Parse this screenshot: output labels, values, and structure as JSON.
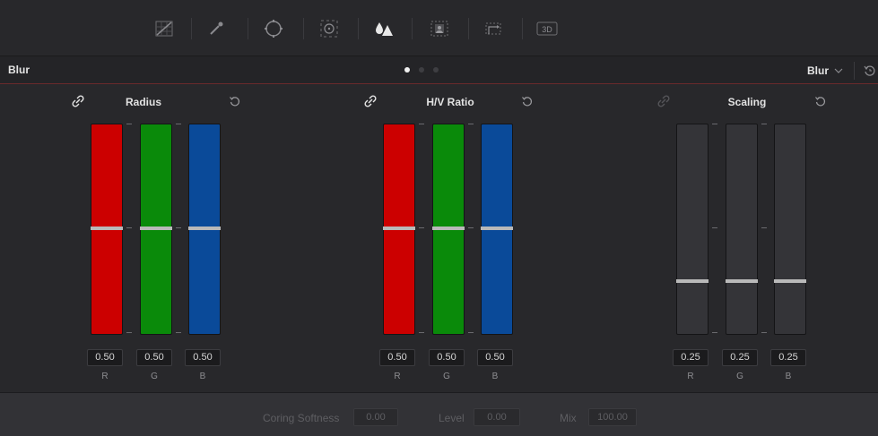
{
  "toolbar": {
    "tools": [
      {
        "id": "curves",
        "icon": "curves-grid-icon"
      },
      {
        "id": "qualifier",
        "icon": "eyedropper-icon"
      },
      {
        "id": "window",
        "icon": "power-window-icon"
      },
      {
        "id": "tracker",
        "icon": "tracker-target-icon"
      },
      {
        "id": "blur",
        "icon": "blur-drops-icon",
        "active": true
      },
      {
        "id": "key",
        "icon": "key-icon"
      },
      {
        "id": "sizing",
        "icon": "sizing-icon"
      },
      {
        "id": "3d",
        "icon": "3d-icon",
        "text": "3D"
      }
    ]
  },
  "header": {
    "title": "Blur",
    "mode_value": "Blur",
    "page_dots": 3,
    "active_dot": 0
  },
  "groups": [
    {
      "label": "Radius",
      "linked": true,
      "channels": [
        {
          "name": "R",
          "value": "0.50",
          "level": 0.5,
          "color": "#cc0000"
        },
        {
          "name": "G",
          "value": "0.50",
          "level": 0.5,
          "color": "#0a8a0a"
        },
        {
          "name": "B",
          "value": "0.50",
          "level": 0.5,
          "color": "#0a4a99"
        }
      ]
    },
    {
      "label": "H/V Ratio",
      "linked": true,
      "channels": [
        {
          "name": "R",
          "value": "0.50",
          "level": 0.5,
          "color": "#cc0000"
        },
        {
          "name": "G",
          "value": "0.50",
          "level": 0.5,
          "color": "#0a8a0a"
        },
        {
          "name": "B",
          "value": "0.50",
          "level": 0.5,
          "color": "#0a4a99"
        }
      ]
    },
    {
      "label": "Scaling",
      "linked": false,
      "channels": [
        {
          "name": "R",
          "value": "0.25",
          "level": 0.25,
          "color": "#343438"
        },
        {
          "name": "G",
          "value": "0.25",
          "level": 0.25,
          "color": "#343438"
        },
        {
          "name": "B",
          "value": "0.25",
          "level": 0.25,
          "color": "#343438"
        }
      ]
    }
  ],
  "footer": {
    "coring_softness_label": "Coring Softness",
    "coring_softness_value": "0.00",
    "level_label": "Level",
    "level_value": "0.00",
    "mix_label": "Mix",
    "mix_value": "100.00"
  },
  "colors": {
    "accent_underline": "#6a2a2c",
    "red": "#cc0000",
    "green": "#0a8a0a",
    "blue": "#0a4a99"
  }
}
